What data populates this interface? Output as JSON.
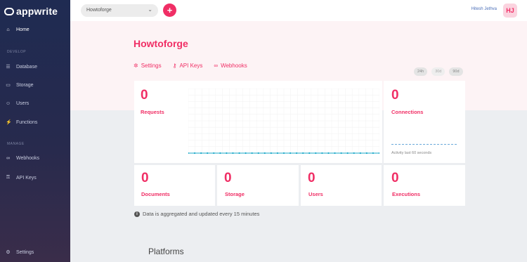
{
  "brand": {
    "name": "appwrite"
  },
  "sidebar": {
    "home": "Home",
    "develop_section": "DEVELOP",
    "develop_items": [
      "Database",
      "Storage",
      "Users",
      "Functions"
    ],
    "manage_section": "MANAGE",
    "manage_items": [
      "Webhooks",
      "API Keys"
    ],
    "settings": "Settings"
  },
  "topbar": {
    "project": "Howtoforge",
    "add_label": "+",
    "user_name": "Hitesh Jethva",
    "avatar_initials": "HJ"
  },
  "header": {
    "title": "Howtoforge",
    "tabs": [
      "Settings",
      "API Keys",
      "Webhooks"
    ],
    "ranges": [
      "24h",
      "30d",
      "90d"
    ]
  },
  "stats": {
    "requests": {
      "value": "0",
      "label": "Requests"
    },
    "connections": {
      "value": "0",
      "label": "Connections",
      "note": "Activity last 60 seconds"
    },
    "documents": {
      "value": "0",
      "label": "Documents"
    },
    "storage": {
      "value": "0",
      "label": "Storage"
    },
    "users": {
      "value": "0",
      "label": "Users"
    },
    "executions": {
      "value": "0",
      "label": "Executions"
    }
  },
  "chart_data": {
    "type": "line",
    "points": [
      0,
      0,
      0,
      0,
      0,
      0,
      0,
      0,
      0,
      0,
      0,
      0,
      0,
      0,
      0,
      0,
      0,
      0,
      0,
      0,
      0,
      0,
      0,
      0,
      0,
      0,
      0,
      0,
      0,
      0,
      0
    ],
    "line_color": "#1aa8c8"
  },
  "note": "Data is aggregated and updated every 15 minutes",
  "platforms_title": "Platforms",
  "colors": {
    "accent": "#f02e65",
    "sidebar": "#1f2b52"
  }
}
